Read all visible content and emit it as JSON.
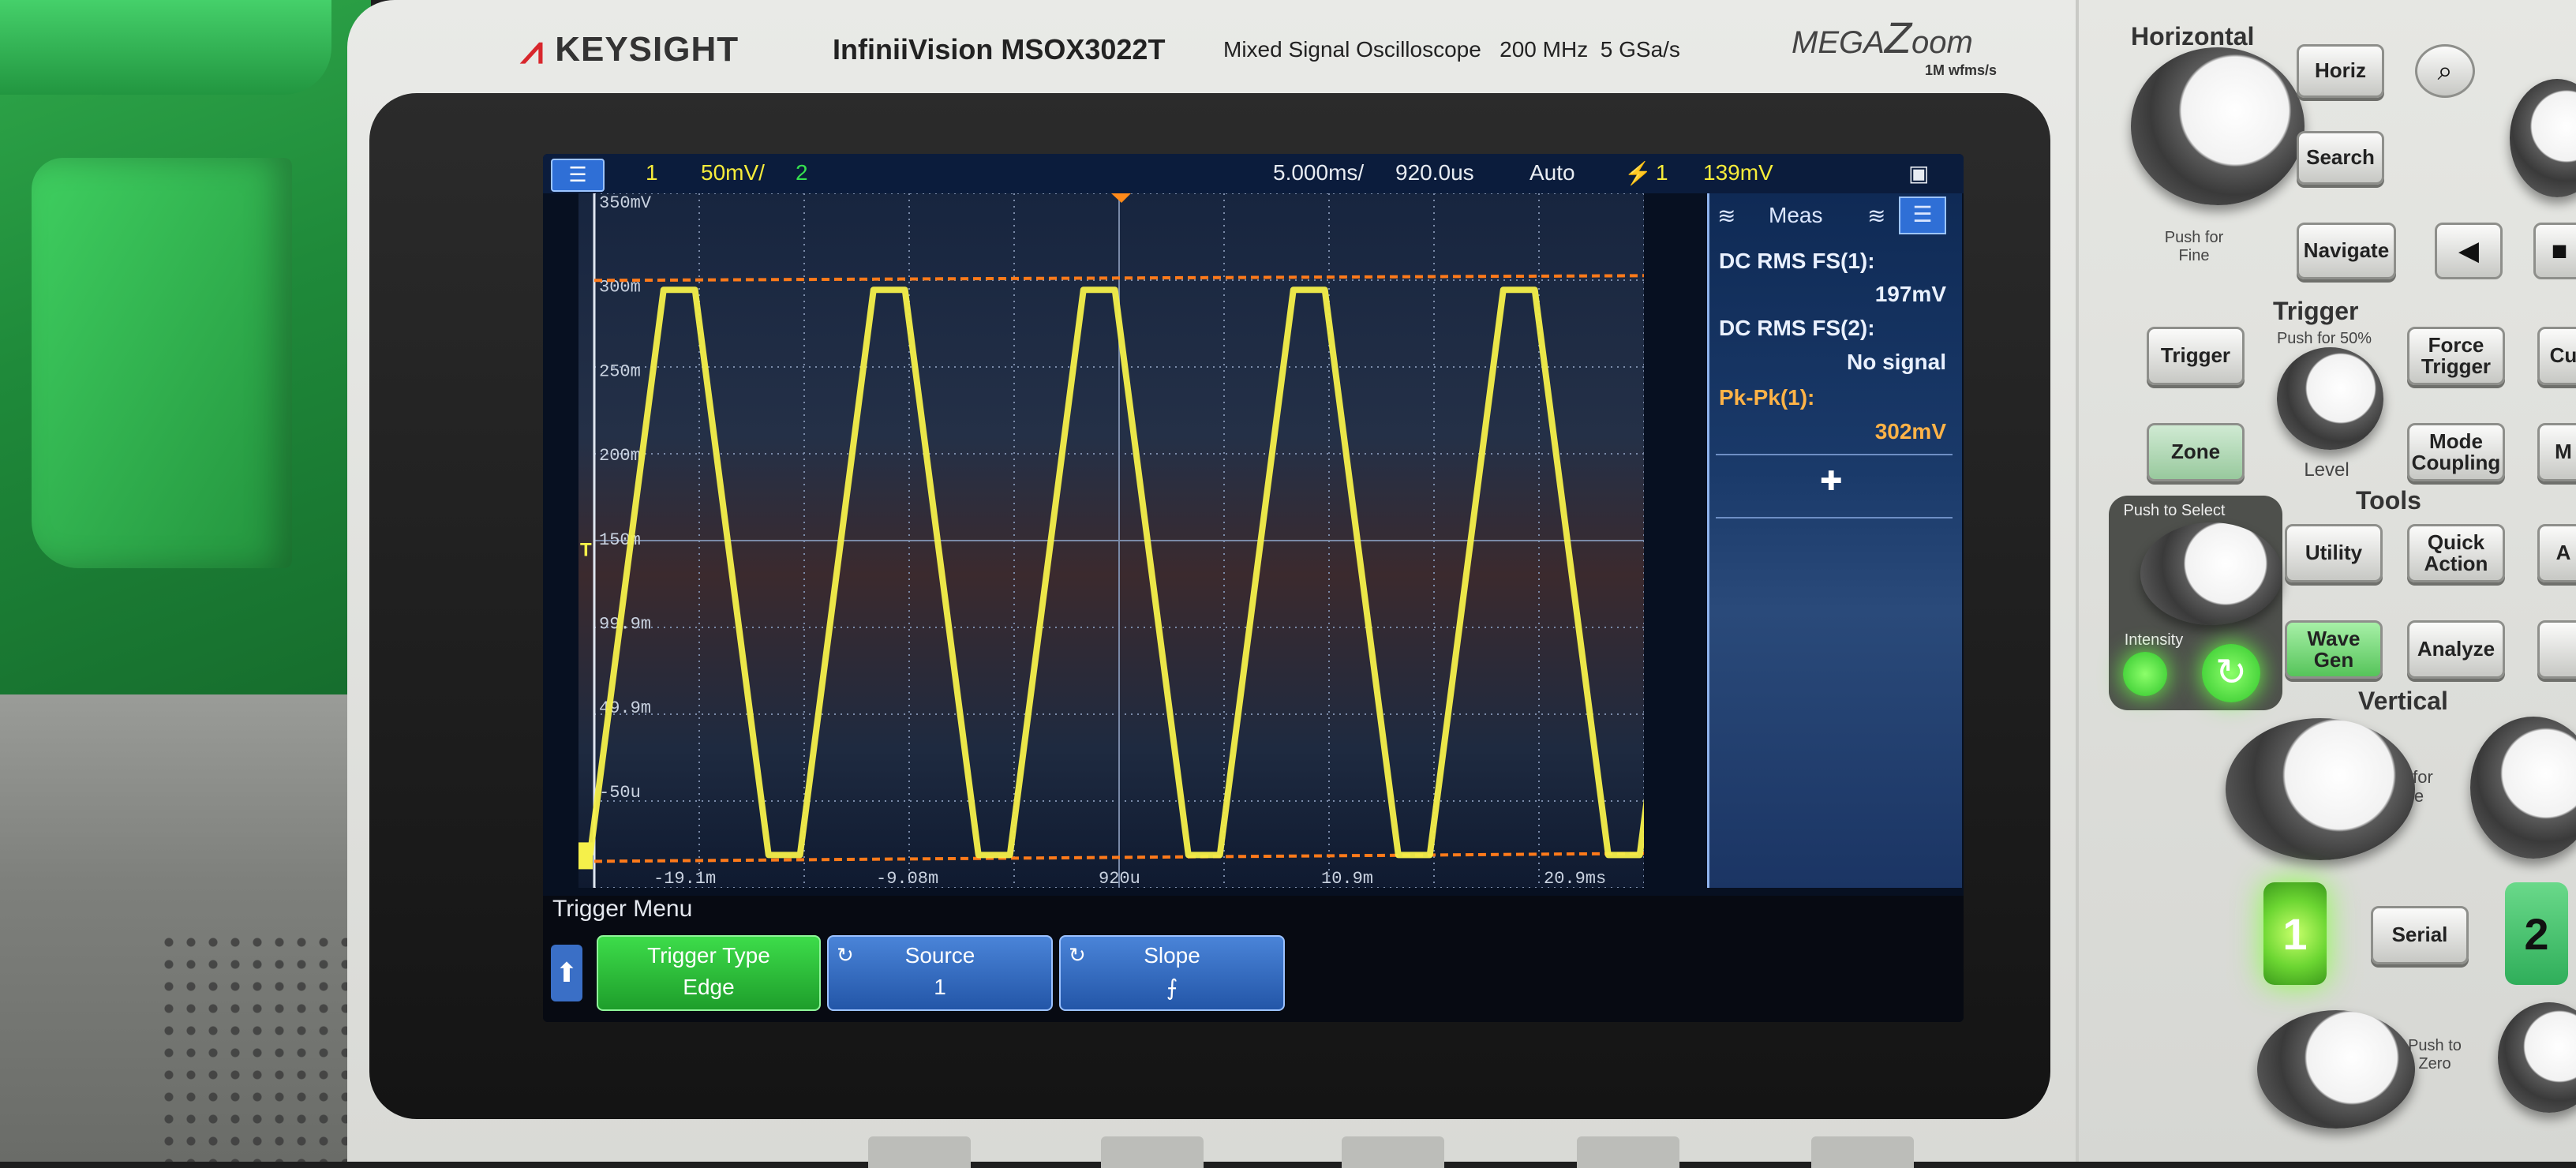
{
  "brand": {
    "logo": "KEYSIGHT",
    "model": "InfiniiVision MSOX3022T",
    "description": "Mixed Signal Oscilloscope",
    "bandwidth": "200 MHz",
    "sample_rate": "5 GSa/s",
    "megazoom_pre": "MEGA",
    "megazoom_z": "Z",
    "megazoom_post": "oom",
    "megazoom_sub": "1M wfms/s"
  },
  "status": {
    "ch1_label": "1",
    "ch1_scale": "50mV/",
    "ch2_label": "2",
    "timebase": "5.000ms/",
    "delay": "920.0us",
    "trigger_mode": "Auto",
    "trigger_source": "1",
    "trigger_level": "139mV"
  },
  "y_axis_labels": [
    "350mV",
    "300m",
    "250m",
    "200m",
    "150m",
    "99.9m",
    "49.9m",
    "-50u"
  ],
  "x_axis_labels": [
    "-19.1m",
    "-9.08m",
    "920u",
    "10.9m",
    "20.9ms"
  ],
  "measurements": {
    "header": "Meas",
    "items": [
      {
        "label": "DC RMS FS(1):",
        "value": "197mV"
      },
      {
        "label": "DC RMS FS(2):",
        "value": "No signal"
      },
      {
        "label": "Pk-Pk(1):",
        "value": "302mV"
      }
    ]
  },
  "softkeys": {
    "menu_title": "Trigger Menu",
    "buttons": [
      {
        "line1": "Trigger Type",
        "line2": "Edge"
      },
      {
        "line1": "Source",
        "line2": "1"
      },
      {
        "line1": "Slope",
        "line2": "⨍"
      }
    ]
  },
  "panel": {
    "horizontal_title": "Horizontal",
    "horiz_key": "Horiz",
    "search_key": "Search",
    "navigate_key": "Navigate",
    "push_for_fine": "Push for Fine",
    "trigger_title": "Trigger",
    "push_for_50": "Push for 50%",
    "trigger_key": "Trigger",
    "force_trigger_key": "Force Trigger",
    "zone_key": "Zone",
    "mode_coupling_key": "Mode Coupling",
    "level_label": "Level",
    "tools_title": "Tools",
    "push_to_select": "Push to Select",
    "utility_key": "Utility",
    "quick_action_key": "Quick Action",
    "intensity_label": "Intensity",
    "wave_gen_key": "Wave Gen",
    "analyze_key": "Analyze",
    "vertical_title": "Vertical",
    "ch1_key": "1",
    "serial_key": "Serial",
    "ch2_key": "2",
    "push_to_zero": "Push to Zero",
    "cut_key": "Cu",
    "for_label": "for",
    "e_label": "e",
    "m_label": "M",
    "a_label": "A",
    "r_label": "A"
  },
  "waveform": {
    "type": "trapezoid",
    "channel": "1",
    "color": "#f5f04a",
    "high_mV": 300,
    "low_mV": -50,
    "period_ms": 10.0,
    "cursor_color": "#ff7a1a",
    "ground_marker": "1",
    "trigger_marker": "T"
  }
}
